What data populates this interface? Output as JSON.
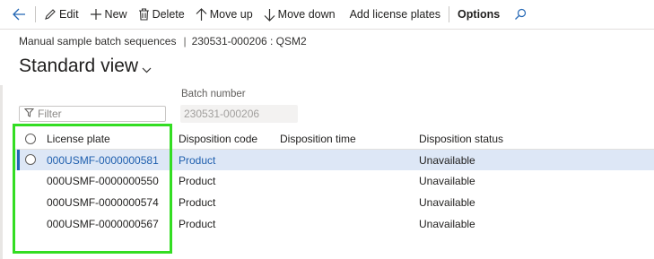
{
  "toolbar": {
    "back_icon": "back-arrow-icon",
    "edit_label": "Edit",
    "new_label": "New",
    "delete_label": "Delete",
    "move_up_label": "Move up",
    "move_down_label": "Move down",
    "add_license_plates_label": "Add license plates",
    "options_label": "Options",
    "search_icon": "search-icon"
  },
  "breadcrumb": {
    "page": "Manual sample batch sequences",
    "separator": "|",
    "record": "230531-000206 : QSM2"
  },
  "view": {
    "title": "Standard view"
  },
  "filter": {
    "placeholder": "Filter",
    "value": ""
  },
  "batch": {
    "label": "Batch number",
    "value": "230531-000206"
  },
  "grid": {
    "columns": [
      "License plate",
      "Disposition code",
      "Disposition time",
      "Disposition status"
    ],
    "rows": [
      {
        "license_plate": "000USMF-0000000581",
        "disposition_code": "Product",
        "disposition_time": "",
        "disposition_status": "Unavailable"
      },
      {
        "license_plate": "000USMF-0000000550",
        "disposition_code": "Product",
        "disposition_time": "",
        "disposition_status": "Unavailable"
      },
      {
        "license_plate": "000USMF-0000000574",
        "disposition_code": "Product",
        "disposition_time": "",
        "disposition_status": "Unavailable"
      },
      {
        "license_plate": "000USMF-0000000567",
        "disposition_code": "Product",
        "disposition_time": "",
        "disposition_status": "Unavailable"
      }
    ],
    "selected_row": 0
  },
  "colors": {
    "accent": "#1f5fae",
    "selected_row_bg": "#dde7f6",
    "highlight_box": "#33dd22"
  }
}
